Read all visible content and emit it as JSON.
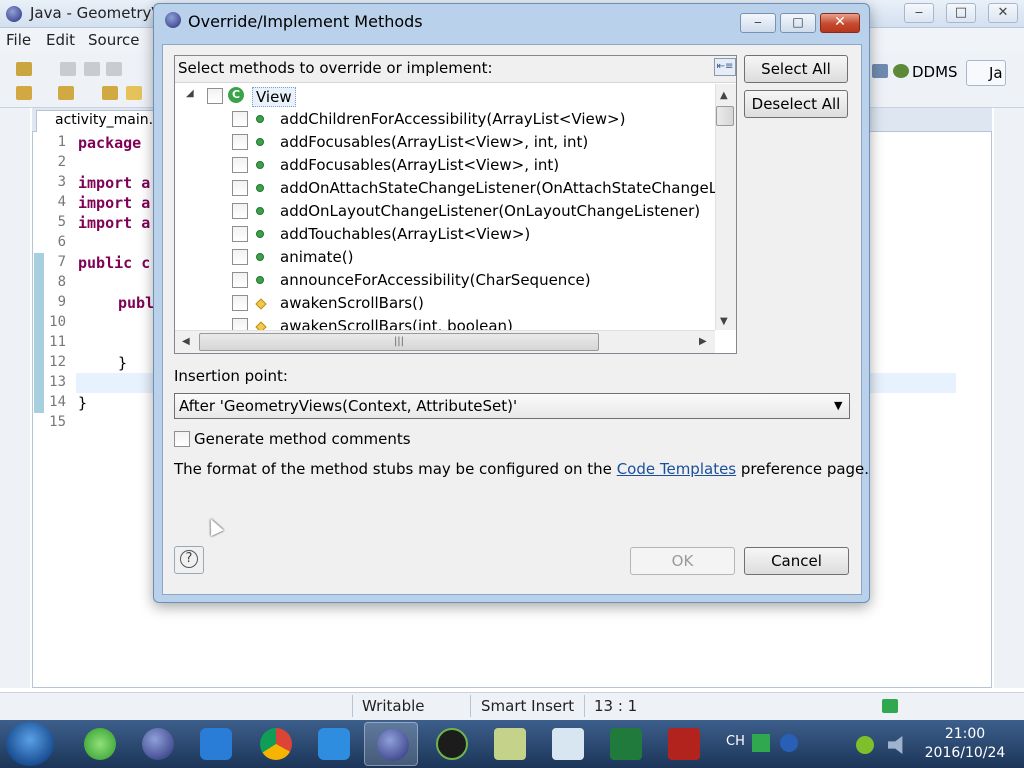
{
  "window": {
    "title": "Java - GeometryV",
    "min": "‒",
    "max": "□",
    "close": "✕"
  },
  "menu": [
    "File",
    "Edit",
    "Source"
  ],
  "perspectives": {
    "ddms": "DDMS",
    "java": "Ja"
  },
  "editor": {
    "tab": "activity_main.",
    "line_numbers": [
      "1",
      "2",
      "3",
      "4",
      "5",
      "6",
      "7",
      "8",
      "9",
      "10",
      "11",
      "12",
      "13",
      "14",
      "15"
    ],
    "lines": {
      "l1": "package",
      "l3": "import a",
      "l4": "import a",
      "l5": "import a",
      "l7": "public c",
      "l9": "publ",
      "l12": "}",
      "l14": "}"
    }
  },
  "statusbar": {
    "mode": "Writable",
    "insert": "Smart Insert",
    "position": "13 : 1"
  },
  "taskbar": {
    "lang": "CH",
    "time": "21:00",
    "date": "2016/10/24"
  },
  "dialog": {
    "title": "Override/Implement Methods",
    "min": "‒",
    "max": "□",
    "close": "✕",
    "select_label": "Select methods to override or implement:",
    "collapse_icon": "collapse-all-icon",
    "tree_root": "View",
    "methods": [
      {
        "name": "addChildrenForAccessibility(ArrayList<View>)",
        "kind": "public"
      },
      {
        "name": "addFocusables(ArrayList<View>, int, int)",
        "kind": "public"
      },
      {
        "name": "addFocusables(ArrayList<View>, int)",
        "kind": "public"
      },
      {
        "name": "addOnAttachStateChangeListener(OnAttachStateChangeLis",
        "kind": "public"
      },
      {
        "name": "addOnLayoutChangeListener(OnLayoutChangeListener)",
        "kind": "public"
      },
      {
        "name": "addTouchables(ArrayList<View>)",
        "kind": "public"
      },
      {
        "name": "animate()",
        "kind": "public"
      },
      {
        "name": "announceForAccessibility(CharSequence)",
        "kind": "public"
      },
      {
        "name": "awakenScrollBars()",
        "kind": "protected"
      },
      {
        "name": "awakenScrollBars(int, boolean)",
        "kind": "protected"
      }
    ],
    "select_all": "Select All",
    "deselect_all": "Deselect All",
    "insertion_label": "Insertion point:",
    "insertion_value": "After 'GeometryViews(Context, AttributeSet)'",
    "generate_comments": "Generate method comments",
    "info_prefix": "The format of the method stubs may be configured on the",
    "info_link": "Code Templates",
    "info_suffix": "preference page.",
    "ok": "OK",
    "cancel": "Cancel",
    "help_icon": "help-icon"
  },
  "colors": {
    "accent": "#1a4f9c",
    "keyword": "#7f0055",
    "public_method": "#3aa34a",
    "protected_method": "#f2c94c"
  }
}
